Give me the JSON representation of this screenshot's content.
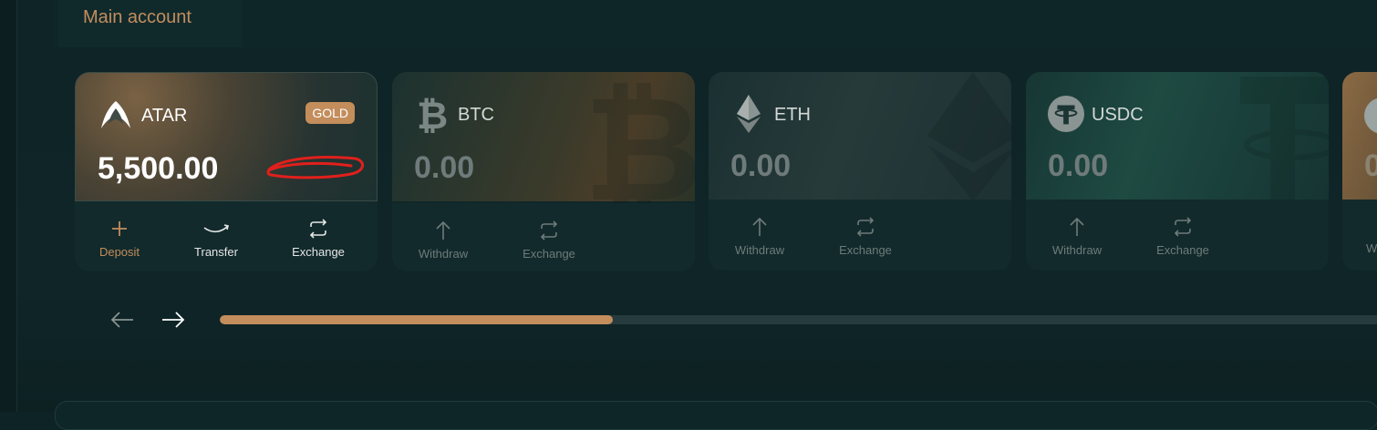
{
  "page": {
    "title": "Main account"
  },
  "colors": {
    "accent": "#c38d5c",
    "background": "#0e2325",
    "muted_text": "#6e7b7a"
  },
  "cards": [
    {
      "name": "ATAR",
      "balance": "5,500.00",
      "badge": "GOLD",
      "icon": "atar-logo-icon",
      "actions": [
        {
          "label": "Deposit",
          "icon": "plus-icon"
        },
        {
          "label": "Transfer",
          "icon": "transfer-icon"
        },
        {
          "label": "Exchange",
          "icon": "exchange-icon"
        }
      ]
    },
    {
      "name": "BTC",
      "balance": "0.00",
      "icon": "bitcoin-icon",
      "actions": [
        {
          "label": "Withdraw",
          "icon": "arrow-up-icon"
        },
        {
          "label": "Exchange",
          "icon": "exchange-icon"
        }
      ]
    },
    {
      "name": "ETH",
      "balance": "0.00",
      "icon": "ethereum-icon",
      "actions": [
        {
          "label": "Withdraw",
          "icon": "arrow-up-icon"
        },
        {
          "label": "Exchange",
          "icon": "exchange-icon"
        }
      ]
    },
    {
      "name": "USDC",
      "balance": "0.00",
      "icon": "tether-icon",
      "actions": [
        {
          "label": "Withdraw",
          "icon": "arrow-up-icon"
        },
        {
          "label": "Exchange",
          "icon": "exchange-icon"
        }
      ]
    },
    {
      "name": "",
      "balance": "0",
      "icon": "coin-icon",
      "actions": [
        {
          "label": "W",
          "icon": "arrow-up-icon"
        }
      ]
    }
  ],
  "carousel": {
    "prev_icon": "arrow-left-icon",
    "next_icon": "arrow-right-icon",
    "progress_fraction": 0.34
  }
}
